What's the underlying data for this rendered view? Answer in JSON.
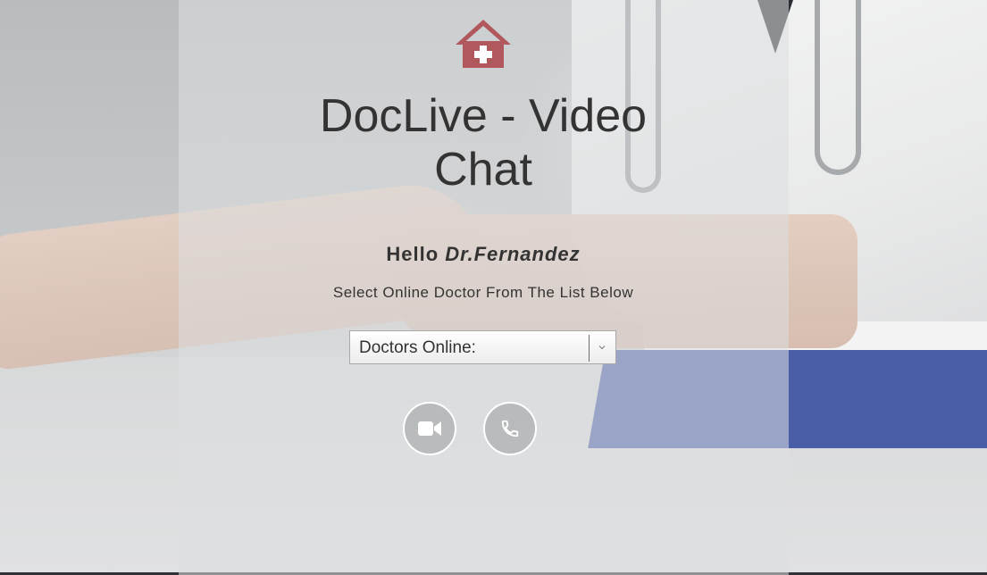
{
  "app": {
    "title": "DocLive - Video Chat"
  },
  "greeting": {
    "prefix": "Hello",
    "doctor_name": "Dr.Fernandez"
  },
  "instruction": "Select Online Doctor From The List Below",
  "doctor_select": {
    "selected_label": "Doctors Online:",
    "options": [
      "Doctors Online:"
    ]
  },
  "actions": {
    "video_icon": "video-camera-icon",
    "phone_icon": "phone-icon"
  },
  "icons": {
    "logo": "house-medical-icon"
  },
  "colors": {
    "logo": "#b0585c",
    "text": "#333333",
    "button_border": "#ffffff"
  }
}
